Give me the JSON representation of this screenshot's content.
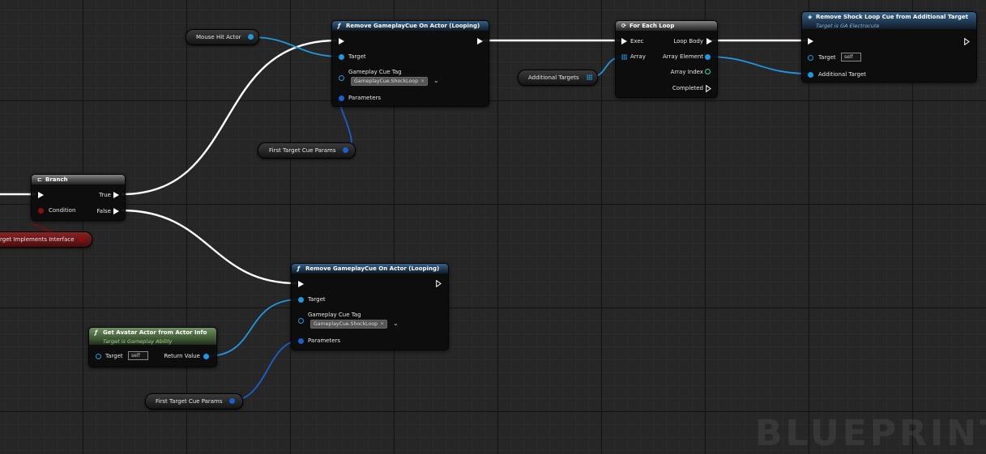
{
  "nodes": {
    "remove_top": {
      "title": "Remove GameplayCue On Actor (Looping)",
      "target": "Target",
      "cue_tag_label": "Gameplay Cue Tag",
      "cue_tag_value": "GameplayCue.ShockLoop",
      "parameters": "Parameters"
    },
    "remove_bottom": {
      "title": "Remove GameplayCue On Actor (Looping)",
      "target": "Target",
      "cue_tag_label": "Gameplay Cue Tag",
      "cue_tag_value": "GameplayCue.ShockLoop",
      "parameters": "Parameters"
    },
    "for_each": {
      "title": "For Each Loop",
      "exec": "Exec",
      "array": "Array",
      "loop_body": "Loop Body",
      "array_element": "Array Element",
      "array_index": "Array Index",
      "completed": "Completed"
    },
    "remove_shock": {
      "title": "Remove Shock Loop Cue from Additional Target",
      "subtitle": "Target is GA Electrocute",
      "target": "Target",
      "target_default": "self",
      "additional_target": "Additional Target"
    },
    "branch": {
      "title": "Branch",
      "condition": "Condition",
      "true_label": "True",
      "false_label": "False"
    },
    "get_avatar": {
      "title": "Get Avatar Actor from Actor Info",
      "subtitle": "Target is Gameplay Ability",
      "target": "Target",
      "target_default": "self",
      "return_value": "Return Value"
    }
  },
  "variables": {
    "mouse_hit_actor": "Mouse Hit Actor",
    "first_target_cue_params_top": "First Target Cue Params",
    "first_target_cue_params_bottom": "First Target Cue Params",
    "additional_targets": "Additional Targets",
    "target_implements_interface": "rget Implements Interface"
  },
  "watermark": "BLUEPRINT",
  "colors": {
    "exec_wire": "#ffffff",
    "object_pin": "#1e98e0",
    "struct_pin": "#1a5fd0",
    "bool_pin": "#8a1010",
    "function_header": "#35628a",
    "pure_header": "#6f9060"
  }
}
